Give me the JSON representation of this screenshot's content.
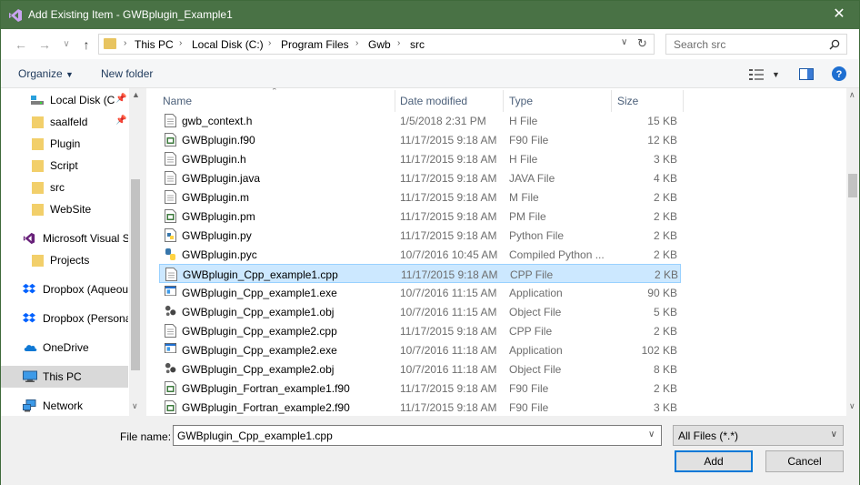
{
  "window": {
    "title": "Add Existing Item - GWBplugin_Example1",
    "close_glyph": "✕"
  },
  "address": {
    "crumbs": [
      "This PC",
      "Local Disk (C:)",
      "Program Files",
      "Gwb",
      "src"
    ]
  },
  "search": {
    "placeholder": "Search src"
  },
  "toolbar": {
    "organize": "Organize",
    "new_folder": "New folder"
  },
  "sidebar": {
    "items": [
      {
        "label": "Local Disk (C:",
        "icon": "drive-icon",
        "pinned": true
      },
      {
        "label": "saalfeld",
        "icon": "folder-icon",
        "pinned": true
      },
      {
        "label": "Plugin",
        "icon": "folder-icon",
        "pinned": false
      },
      {
        "label": "Script",
        "icon": "folder-icon",
        "pinned": false
      },
      {
        "label": "src",
        "icon": "folder-icon",
        "pinned": false
      },
      {
        "label": "WebSite",
        "icon": "folder-icon",
        "pinned": false
      },
      {
        "label": "Microsoft Visual S",
        "icon": "visual-studio-icon",
        "pinned": false
      },
      {
        "label": "Projects",
        "icon": "folder-icon",
        "pinned": false
      },
      {
        "label": "Dropbox (Aqueou",
        "icon": "dropbox-icon",
        "pinned": false
      },
      {
        "label": "Dropbox (Persona",
        "icon": "dropbox-icon",
        "pinned": false
      },
      {
        "label": "OneDrive",
        "icon": "onedrive-icon",
        "pinned": false
      },
      {
        "label": "This PC",
        "icon": "this-pc-icon",
        "pinned": false,
        "selected": true
      },
      {
        "label": "Network",
        "icon": "network-icon",
        "pinned": false
      }
    ]
  },
  "columns": {
    "name": "Name",
    "date": "Date modified",
    "type": "Type",
    "size": "Size"
  },
  "files": [
    {
      "name": "gwb_context.h",
      "date": "1/5/2018 2:31 PM",
      "type": "H File",
      "size": "15 KB",
      "icon": "text-file-icon"
    },
    {
      "name": "GWBplugin.f90",
      "date": "11/17/2015 9:18 AM",
      "type": "F90 File",
      "size": "12 KB",
      "icon": "fortran-file-icon"
    },
    {
      "name": "GWBplugin.h",
      "date": "11/17/2015 9:18 AM",
      "type": "H File",
      "size": "3 KB",
      "icon": "text-file-icon"
    },
    {
      "name": "GWBplugin.java",
      "date": "11/17/2015 9:18 AM",
      "type": "JAVA File",
      "size": "4 KB",
      "icon": "text-file-icon"
    },
    {
      "name": "GWBplugin.m",
      "date": "11/17/2015 9:18 AM",
      "type": "M File",
      "size": "2 KB",
      "icon": "text-file-icon"
    },
    {
      "name": "GWBplugin.pm",
      "date": "11/17/2015 9:18 AM",
      "type": "PM File",
      "size": "2 KB",
      "icon": "perl-file-icon"
    },
    {
      "name": "GWBplugin.py",
      "date": "11/17/2015 9:18 AM",
      "type": "Python File",
      "size": "2 KB",
      "icon": "python-file-icon"
    },
    {
      "name": "GWBplugin.pyc",
      "date": "10/7/2016 10:45 AM",
      "type": "Compiled Python ...",
      "size": "2 KB",
      "icon": "compiled-python-icon"
    },
    {
      "name": "GWBplugin_Cpp_example1.cpp",
      "date": "11/17/2015 9:18 AM",
      "type": "CPP File",
      "size": "2 KB",
      "icon": "text-file-icon",
      "selected": true
    },
    {
      "name": "GWBplugin_Cpp_example1.exe",
      "date": "10/7/2016 11:15 AM",
      "type": "Application",
      "size": "90 KB",
      "icon": "application-icon"
    },
    {
      "name": "GWBplugin_Cpp_example1.obj",
      "date": "10/7/2016 11:15 AM",
      "type": "Object File",
      "size": "5 KB",
      "icon": "object-file-icon"
    },
    {
      "name": "GWBplugin_Cpp_example2.cpp",
      "date": "11/17/2015 9:18 AM",
      "type": "CPP File",
      "size": "2 KB",
      "icon": "text-file-icon"
    },
    {
      "name": "GWBplugin_Cpp_example2.exe",
      "date": "10/7/2016 11:18 AM",
      "type": "Application",
      "size": "102 KB",
      "icon": "application-icon"
    },
    {
      "name": "GWBplugin_Cpp_example2.obj",
      "date": "10/7/2016 11:18 AM",
      "type": "Object File",
      "size": "8 KB",
      "icon": "object-file-icon"
    },
    {
      "name": "GWBplugin_Fortran_example1.f90",
      "date": "11/17/2015 9:18 AM",
      "type": "F90 File",
      "size": "2 KB",
      "icon": "fortran-file-icon"
    },
    {
      "name": "GWBplugin_Fortran_example2.f90",
      "date": "11/17/2015 9:18 AM",
      "type": "F90 File",
      "size": "3 KB",
      "icon": "fortran-file-icon"
    }
  ],
  "bottom": {
    "file_name_label": "File name:",
    "file_name_value": "GWBplugin_Cpp_example1.cpp",
    "filter": "All Files (*.*)",
    "add": "Add",
    "cancel": "Cancel"
  },
  "colors": {
    "titlebar": "#497245",
    "selection": "#cce8ff",
    "accent": "#0078d7"
  }
}
